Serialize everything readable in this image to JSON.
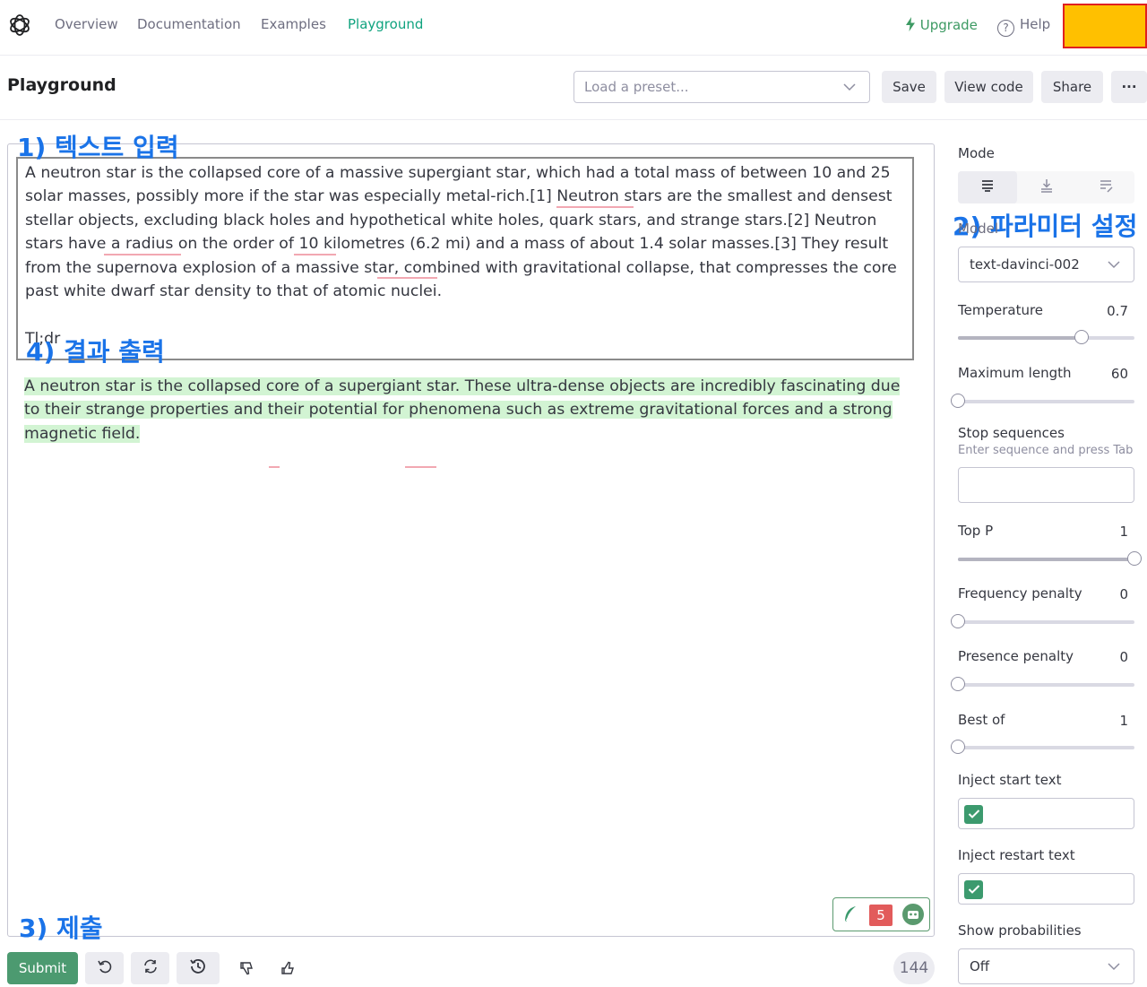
{
  "nav": {
    "items": [
      "Overview",
      "Documentation",
      "Examples",
      "Playground"
    ],
    "upgrade": "Upgrade",
    "help": "Help"
  },
  "header": {
    "title": "Playground",
    "preset_placeholder": "Load a preset...",
    "save": "Save",
    "view_code": "View code",
    "share": "Share",
    "more": "···"
  },
  "editor": {
    "prompt": "A neutron star is the collapsed core of a massive supergiant star, which had a total mass of between 10 and 25 solar masses, possibly more if the star was especially metal-rich.[1] Neutron stars are the smallest and densest stellar objects, excluding black holes and hypothetical white holes, quark stars, and strange stars.[2] Neutron stars have a radius on the order of 10 kilometres (6.2 mi) and a mass of about 1.4 solar masses.[3] They result from the supernova explosion of a massive star, combined with gravitational collapse, that compresses the core past white dwarf star density to that of atomic nuclei.\n\nTl;dr",
    "output": "A neutron star is the collapsed core of a supergiant star. These ultra-dense objects are incredibly fascinating due to their strange properties and their potential for phenomena such as extreme gravitational forces and a strong magnetic field."
  },
  "annotations": {
    "text_input": "1) 텍스트 입력",
    "parameters": "2) 파라미터 설정",
    "submit": "3) 제출",
    "output": "4) 결과 출력"
  },
  "toolbar": {
    "submit": "Submit",
    "token_count": "144",
    "extension_badge": "5"
  },
  "panel": {
    "mode_label": "Mode",
    "model_label": "Model",
    "model_value": "text-davinci-002",
    "temperature": {
      "label": "Temperature",
      "value": "0.7",
      "fraction": 0.7
    },
    "max_length": {
      "label": "Maximum length",
      "value": "60",
      "fraction": 0.0
    },
    "stop_sequences": {
      "label": "Stop sequences",
      "hint": "Enter sequence and press Tab"
    },
    "top_p": {
      "label": "Top P",
      "value": "1",
      "fraction": 1.0
    },
    "frequency_penalty": {
      "label": "Frequency penalty",
      "value": "0",
      "fraction": 0.0
    },
    "presence_penalty": {
      "label": "Presence penalty",
      "value": "0",
      "fraction": 0.0
    },
    "best_of": {
      "label": "Best of",
      "value": "1",
      "fraction": 0.0
    },
    "inject_start": {
      "label": "Inject start text",
      "checked": true
    },
    "inject_restart": {
      "label": "Inject restart text",
      "checked": true
    },
    "show_probabilities": {
      "label": "Show probabilities",
      "value": "Off"
    }
  }
}
